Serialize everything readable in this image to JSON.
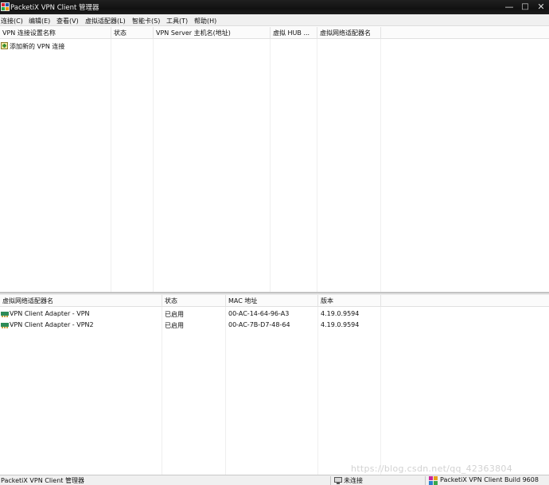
{
  "window": {
    "title": "PacketiX VPN Client 管理器",
    "controls": {
      "minimize": "—",
      "maximize": "□",
      "close": "✕"
    }
  },
  "menu": [
    "连接(C)",
    "编辑(E)",
    "查看(V)",
    "虚拟适配器(L)",
    "智能卡(S)",
    "工具(T)",
    "帮助(H)"
  ],
  "connections": {
    "columns": [
      "VPN 连接设置名称",
      "状态",
      "VPN Server 主机名(地址)",
      "虚拟 HUB ...",
      "虚拟网络适配器名"
    ],
    "rows": [
      {
        "name": "添加新的 VPN 连接",
        "icon": "add-connection-icon"
      }
    ]
  },
  "adapters": {
    "columns": [
      "虚拟网络适配器名",
      "状态",
      "MAC 地址",
      "版本"
    ],
    "rows": [
      {
        "name": "VPN Client Adapter - VPN",
        "status": "已启用",
        "mac": "00-AC-14-64-96-A3",
        "version": "4.19.0.9594",
        "icon": "network-adapter-icon"
      },
      {
        "name": "VPN Client Adapter - VPN2",
        "status": "已启用",
        "mac": "00-AC-7B-D7-48-64",
        "version": "4.19.0.9594",
        "icon": "network-adapter-icon"
      }
    ]
  },
  "statusbar": {
    "app": "PacketiX VPN Client 管理器",
    "connection": "未连接",
    "build": "PacketiX VPN Client Build 9608"
  },
  "watermark": "https://blog.csdn.net/qq_42363804",
  "colors": {
    "titlebar": "#111111",
    "menubar": "#f0f0f0",
    "adapter_icon": "#2e8b57"
  }
}
